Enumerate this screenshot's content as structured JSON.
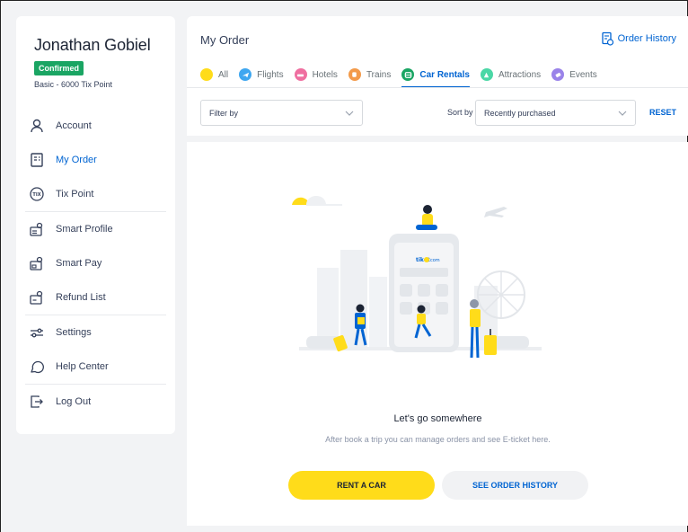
{
  "profile": {
    "name": "Jonathan Gobiel",
    "status": "Confirmed",
    "tier": "Basic - 6000 Tix Point"
  },
  "sidebar": {
    "items": [
      {
        "label": "Account",
        "icon": "user-icon"
      },
      {
        "label": "My Order",
        "icon": "order-icon",
        "active": true
      },
      {
        "label": "Tix Point",
        "icon": "tix-coin-icon"
      },
      {
        "label": "Smart Profile",
        "icon": "smart-profile-icon"
      },
      {
        "label": "Smart Pay",
        "icon": "smart-pay-icon"
      },
      {
        "label": "Refund List",
        "icon": "refund-icon"
      },
      {
        "label": "Settings",
        "icon": "settings-sliders-icon"
      },
      {
        "label": "Help Center",
        "icon": "chat-bubble-icon"
      },
      {
        "label": "Log Out",
        "icon": "logout-icon"
      }
    ]
  },
  "header": {
    "title": "My Order",
    "order_history": "Order History",
    "tabs": [
      {
        "label": "All",
        "color": "#ffdc1a",
        "icon": "all-icon"
      },
      {
        "label": "Flights",
        "color": "#3fa7f0",
        "icon": "plane-icon"
      },
      {
        "label": "Hotels",
        "color": "#ef6fa0",
        "icon": "bed-icon"
      },
      {
        "label": "Trains",
        "color": "#f39a4a",
        "icon": "train-icon"
      },
      {
        "label": "Car Rentals",
        "color": "#1aa563",
        "icon": "car-icon",
        "active": true
      },
      {
        "label": "Attractions",
        "color": "#4bd7a6",
        "icon": "attraction-icon"
      },
      {
        "label": "Events",
        "color": "#9a83e9",
        "icon": "ticket-icon"
      }
    ]
  },
  "filters": {
    "filter_by": "Filter by",
    "sort_by_label": "Sort by",
    "sort_value": "Recently purchased",
    "reset": "RESET"
  },
  "empty_state": {
    "brand": "tiket",
    "brand_suffix": "com",
    "title": "Let's go somewhere",
    "subtitle": "After book a trip you can manage orders and see E-ticket here.",
    "primary_button": "RENT A CAR",
    "secondary_button": "SEE ORDER HISTORY"
  },
  "colors": {
    "accent": "#0064d2",
    "confirmed": "#1aa563",
    "primary_button": "#ffdc1a"
  }
}
